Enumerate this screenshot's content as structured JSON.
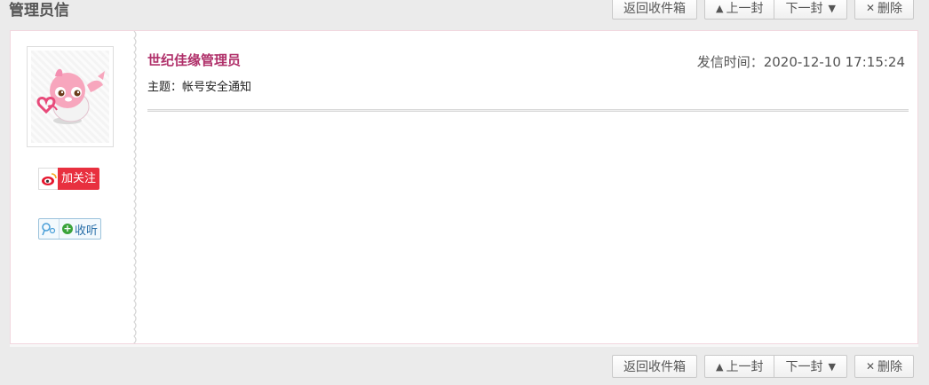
{
  "page": {
    "title": "管理员信"
  },
  "toolbar": {
    "back_inbox": "返回收件箱",
    "prev": "上一封",
    "next": "下一封",
    "delete": "删除",
    "prev_icon": "triangle-up-icon",
    "next_icon": "chevron-down-icon",
    "delete_icon": "close-icon"
  },
  "message": {
    "sender": "世纪佳缘管理员",
    "send_time": "发信时间：2020-12-10 17:15:24",
    "subject": "主题：帐号安全通知",
    "body": ""
  },
  "social": {
    "weibo_label": "加关注",
    "weibo_icon": "weibo-icon",
    "tq_label": "收听",
    "tq_icon": "tencent-weibo-icon",
    "tq_plus": "+"
  },
  "colors": {
    "sender": "#b0306a",
    "weibo": "#e8303f",
    "border_pink": "#f2d7df"
  }
}
